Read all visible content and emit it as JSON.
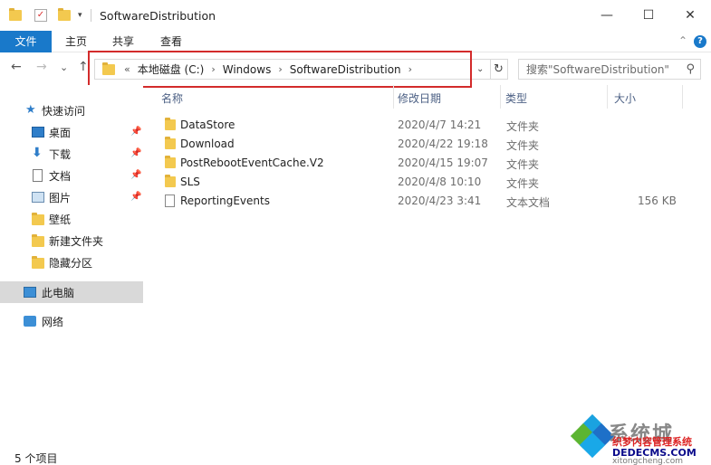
{
  "window": {
    "title": "SoftwareDistribution",
    "minimize": "—",
    "maximize": "☐",
    "close": "✕"
  },
  "ribbon": {
    "tabs": [
      "文件",
      "主页",
      "共享",
      "查看"
    ],
    "collapse": "⌃",
    "help": "?"
  },
  "nav": {
    "back": "←",
    "forward": "→",
    "recent": "⌄",
    "up": "↑",
    "overflow": "«",
    "breadcrumbs": [
      "本地磁盘 (C:)",
      "Windows",
      "SoftwareDistribution"
    ],
    "search_placeholder": "搜索\"SoftwareDistribution\""
  },
  "sidebar": {
    "items": [
      {
        "label": "快速访问",
        "icon": "star-icon"
      },
      {
        "label": "桌面",
        "icon": "desktop-icon",
        "pinned": true
      },
      {
        "label": "下载",
        "icon": "download-icon",
        "pinned": true
      },
      {
        "label": "文档",
        "icon": "document-icon",
        "pinned": true
      },
      {
        "label": "图片",
        "icon": "picture-icon",
        "pinned": true
      },
      {
        "label": "壁纸",
        "icon": "folder-icon"
      },
      {
        "label": "新建文件夹",
        "icon": "folder-icon"
      },
      {
        "label": "隐藏分区",
        "icon": "folder-icon"
      },
      {
        "label": "此电脑",
        "icon": "computer-icon",
        "selected": true
      },
      {
        "label": "网络",
        "icon": "network-icon"
      }
    ]
  },
  "columns": {
    "name": "名称",
    "modified": "修改日期",
    "type": "类型",
    "size": "大小"
  },
  "files": [
    {
      "name": "DataStore",
      "modified": "2020/4/7 14:21",
      "type": "文件夹",
      "size": "",
      "icon": "folder-icon"
    },
    {
      "name": "Download",
      "modified": "2020/4/22 19:18",
      "type": "文件夹",
      "size": "",
      "icon": "folder-icon"
    },
    {
      "name": "PostRebootEventCache.V2",
      "modified": "2020/4/15 19:07",
      "type": "文件夹",
      "size": "",
      "icon": "folder-icon"
    },
    {
      "name": "SLS",
      "modified": "2020/4/8 10:10",
      "type": "文件夹",
      "size": "",
      "icon": "folder-icon"
    },
    {
      "name": "ReportingEvents",
      "modified": "2020/4/23 3:41",
      "type": "文本文档",
      "size": "156 KB",
      "icon": "text-file-icon"
    }
  ],
  "status": {
    "count": "5 个项目"
  },
  "watermark": {
    "brand": "系统城",
    "line1": "织梦内容管理系统",
    "line2": "DEDECMS.COM",
    "line3": "xitongcheng.com"
  },
  "colors": {
    "accent": "#1979ca",
    "folder": "#f3c94f",
    "highlight_box": "#d32b2b"
  }
}
